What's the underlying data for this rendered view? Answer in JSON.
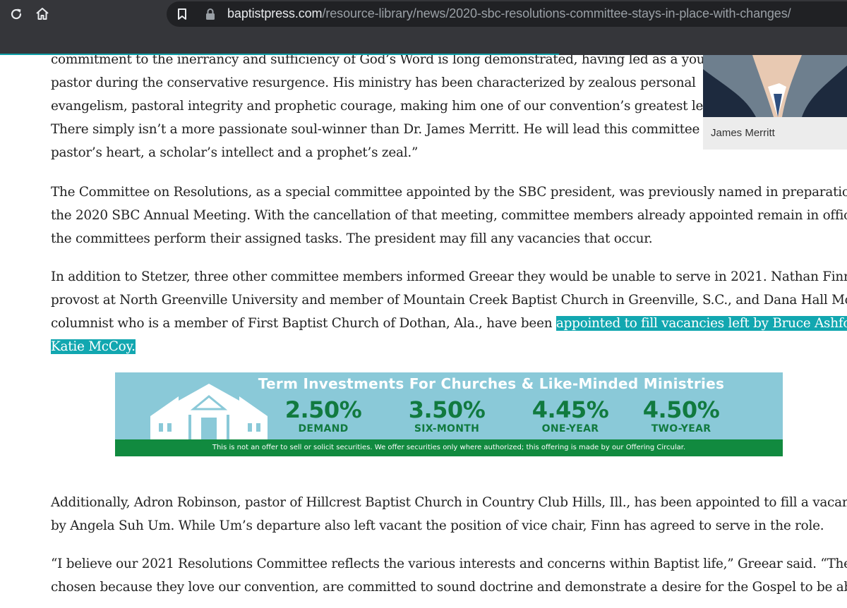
{
  "browser": {
    "url_domain": "baptistpress.com",
    "url_path": "/resource-library/news/2020-sbc-resolutions-committee-stays-in-place-with-changes/",
    "reload_icon": "reload-icon",
    "home_icon": "home-icon",
    "bookmark_icon": "bookmark-icon",
    "lock_icon": "lock-icon"
  },
  "article": {
    "p1": [
      "commitment to the inerrancy and sufficiency of God’s Word is long demonstrated, having led as a young",
      "pastor during the conservative resurgence. His ministry has been characterized by zealous personal",
      "evangelism, pastoral integrity and prophetic courage, making him one of our convention’s greatest leaders.",
      "There simply isn’t a more passionate soul-winner than Dr. James Merritt. He will lead this committee with a",
      "pastor’s heart, a scholar’s intellect and a prophet’s zeal.”"
    ],
    "p2": [
      "The Committee on Resolutions, as a special committee appointed by the SBC president, was previously named in preparation for",
      "the 2020 SBC Annual Meeting. With the cancellation of that meeting, committee members already appointed remain in office until",
      "the committees perform their assigned tasks. The president may fill any vacancies that occur."
    ],
    "p3": {
      "lines": [
        "In addition to Stetzer, three other committee members informed Greear they would be unable to serve in 2021. Nathan Finn,",
        "provost at North Greenville University and member of Mountain Creek Baptist Church in Greenville, S.C., and Dana Hall McCain, a"
      ],
      "line3_text": "columnist who is a member of First Baptist Church of Dothan, Ala., have been ",
      "line3_highlight": "appointed to fill vacancies left by Bruce Ashford and",
      "line4_highlight": "Katie McCoy."
    },
    "p4": [
      "Additionally, Adron Robinson, pastor of Hillcrest Baptist Church in Country Club Hills, Ill., has been appointed to fill a vacancy left",
      "by Angela Suh Um. While Um’s departure also left vacant the position of vice chair, Finn has agreed to serve in the role."
    ],
    "p5": [
      "“I believe our 2021 Resolutions Committee reflects the various interests and concerns within Baptist life,” Greear said. “They were",
      "chosen because they love our convention, are committed to sound doctrine and demonstrate a desire for the Gospel to be above all."
    ]
  },
  "photo": {
    "caption": "James Merritt"
  },
  "ad": {
    "title": "Term Investments For Churches & Like-Minded Ministries",
    "rates": [
      {
        "value": "2.50%",
        "label": "DEMAND"
      },
      {
        "value": "3.50%",
        "label": "SIX-MONTH"
      },
      {
        "value": "4.45%",
        "label": "ONE-YEAR"
      },
      {
        "value": "4.50%",
        "label": "TWO-YEAR"
      }
    ],
    "disclaimer": "This is not an offer to sell or solicit securities. We offer securities only where authorized; this offering is made by our Offering Circular.",
    "colors": {
      "background": "#8ac9d8",
      "green": "#118a3f"
    }
  },
  "colors": {
    "highlight": "#12a7b0",
    "toolbar": "#35363a",
    "progress": "#10a0a8"
  }
}
